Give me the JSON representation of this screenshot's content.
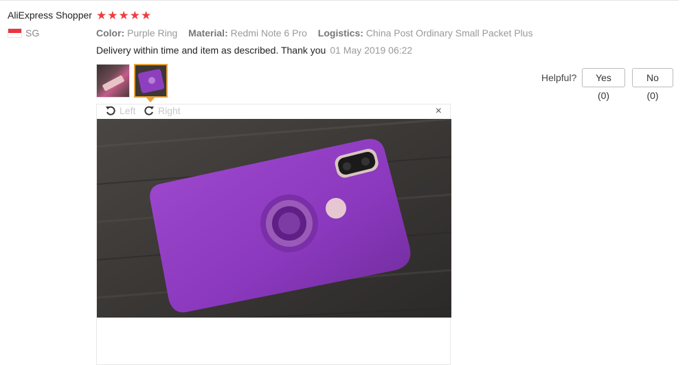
{
  "review": {
    "username": "AliExpress Shopper",
    "rating": 5,
    "country_code": "SG",
    "attributes": [
      {
        "label": "Color:",
        "value": "Purple Ring"
      },
      {
        "label": "Material:",
        "value": "Redmi Note 6 Pro"
      },
      {
        "label": "Logistics:",
        "value": "China Post Ordinary Small Packet Plus"
      }
    ],
    "text": "Delivery within time and item as described. Thank you",
    "date": "01 May 2019 06:22"
  },
  "viewer": {
    "rotate_left_label": "Left",
    "rotate_right_label": "Right",
    "close_symbol": "×"
  },
  "helpful": {
    "label": "Helpful?",
    "yes_label": "Yes (0)",
    "no_label": "No (0)"
  },
  "colors": {
    "star": "#f03b3f",
    "active_thumb_border": "#e8a036",
    "phone_case": "#8e3fbf"
  },
  "icons": [
    "star-icon",
    "sg-flag-icon",
    "rotate-left-icon",
    "rotate-right-icon",
    "close-icon"
  ]
}
